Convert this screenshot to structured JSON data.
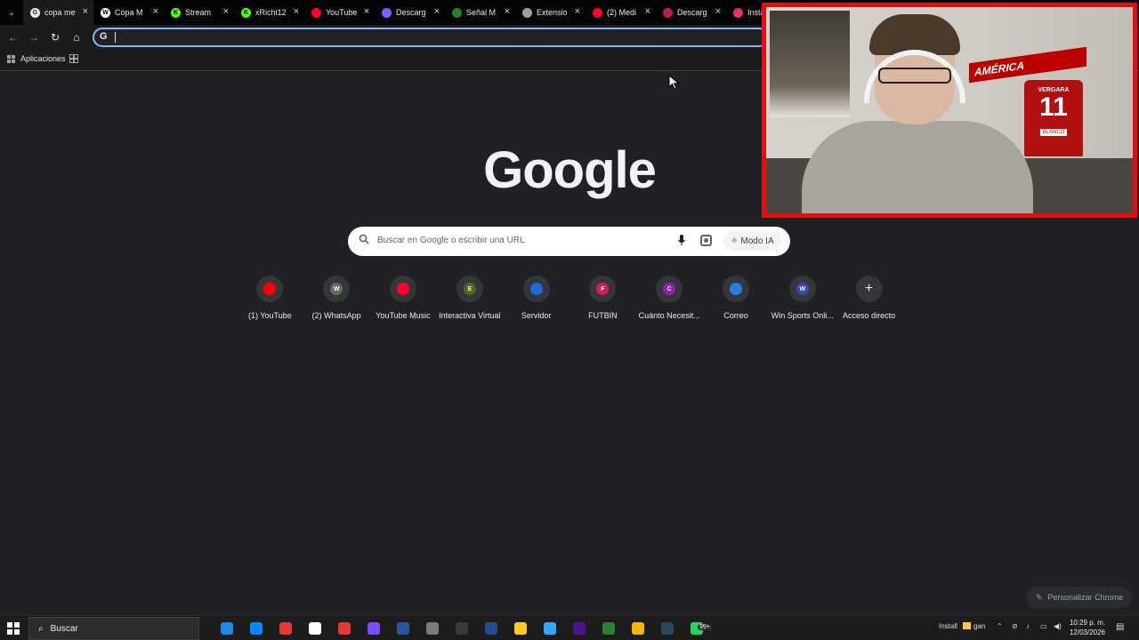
{
  "tabs": [
    {
      "title": "copa me",
      "color": "#e8eaed",
      "glyph": "G",
      "glyph_color": "#202124"
    },
    {
      "title": "Copa M",
      "color": "#ffffff",
      "glyph": "W",
      "glyph_color": "#000000"
    },
    {
      "title": "Stream",
      "color": "#53fc18",
      "glyph": "K",
      "glyph_color": "#000000"
    },
    {
      "title": "xRichi12",
      "color": "#53fc18",
      "glyph": "K",
      "glyph_color": "#000000"
    },
    {
      "title": "YouTube",
      "color": "#ff0033",
      "glyph": "",
      "glyph_color": "#ffffff"
    },
    {
      "title": "Descarg",
      "color": "#7b61ff",
      "glyph": "",
      "glyph_color": "#ffffff"
    },
    {
      "title": "Señal M",
      "color": "#2e7d32",
      "glyph": "",
      "glyph_color": "#ffffff"
    },
    {
      "title": "Extensio",
      "color": "#9aa0a6",
      "glyph": "",
      "glyph_color": "#ffffff"
    },
    {
      "title": "(2) Medi",
      "color": "#ff0033",
      "glyph": "",
      "glyph_color": "#ffffff"
    },
    {
      "title": "Descarg",
      "color": "#c2185b",
      "glyph": "",
      "glyph_color": "#ffffff"
    },
    {
      "title": "Insta",
      "color": "#e1306c",
      "glyph": "",
      "glyph_color": "#ffffff"
    }
  ],
  "bookmarks": {
    "apps_label": "Aplicaciones"
  },
  "google": {
    "logo": "Google"
  },
  "search": {
    "placeholder": "Buscar en Google o escribir una URL",
    "ai_mode_label": "Modo IA"
  },
  "shortcuts": [
    {
      "label": "(1) YouTube",
      "letter": "",
      "color": "#ff0000"
    },
    {
      "label": "(2) WhatsApp",
      "letter": "W",
      "color": "#5f6f5a"
    },
    {
      "label": "YouTube Music",
      "letter": "",
      "color": "#ff0033"
    },
    {
      "label": "Interactiva Virtual",
      "letter": "E",
      "color": "#4d6b1f"
    },
    {
      "label": "Servidor",
      "letter": "",
      "color": "#1e6ad6"
    },
    {
      "label": "FUTBIN",
      "letter": "F",
      "color": "#d81b60"
    },
    {
      "label": "Cuánto Necesit...",
      "letter": "C",
      "color": "#8e24aa"
    },
    {
      "label": "Correo",
      "letter": "",
      "color": "#2a7be4"
    },
    {
      "label": "Win Sports Onli...",
      "letter": "W",
      "color": "#3949ab"
    },
    {
      "label": "Acceso directo",
      "letter": "+",
      "color": "#35363a"
    }
  ],
  "customize_label": "Personalizar Chrome",
  "webcam": {
    "scarf_text": "AMÉRICA",
    "jersey_name": "VERGARA",
    "jersey_number": "11",
    "jersey_sub": "BLANCO"
  },
  "taskbar": {
    "search_label": "Buscar",
    "tray_install": "Install",
    "tray_gan": "gan",
    "time": "10:29 p. m.",
    "date": "12/03/2026",
    "badge": "99+",
    "apps": [
      "#1e88e5",
      "#0a84ff",
      "#e53935",
      "#ffffff",
      "#e53935",
      "#7c4dff",
      "#2b579a",
      "#7a7a7a",
      "#3a3a3a",
      "#264a8a",
      "#ffca28",
      "#31a8ff",
      "#4a148c",
      "#2e7d32",
      "#f4b400",
      "#2a475e",
      "#25d366"
    ]
  },
  "colors": {
    "background": "#202124",
    "accent": "#8ab4f8",
    "webcam_border": "#dd1111"
  }
}
